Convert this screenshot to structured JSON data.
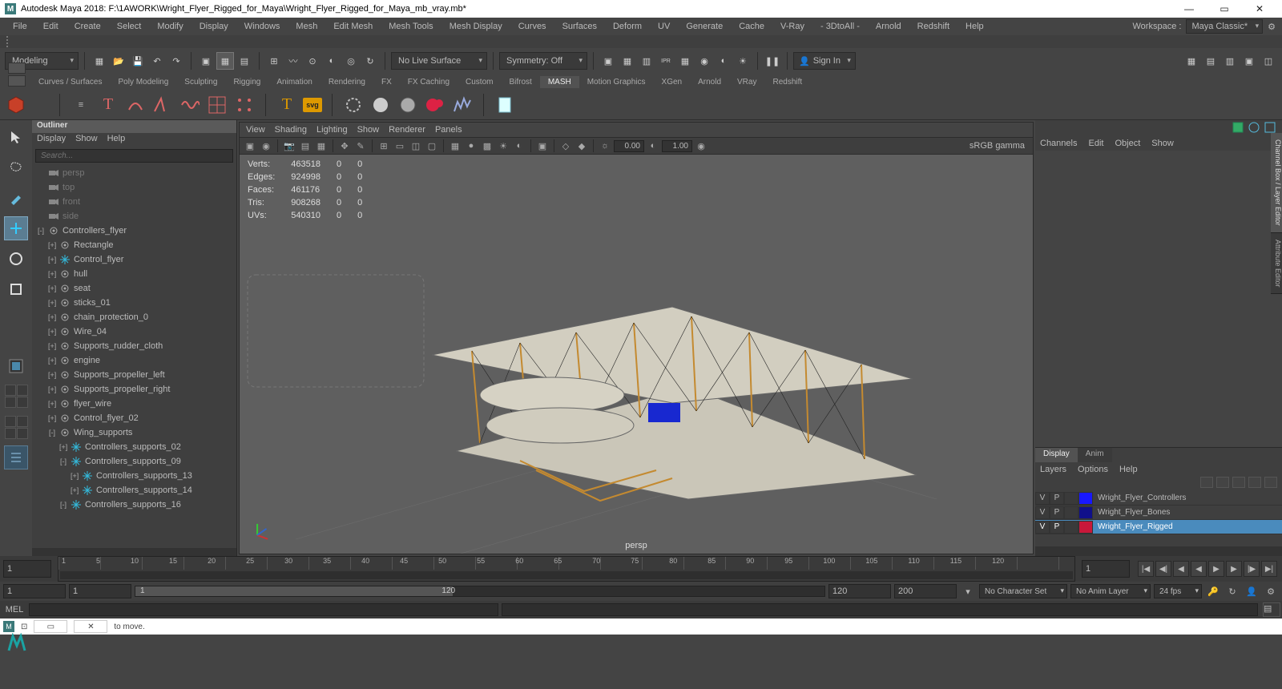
{
  "window": {
    "title": "Autodesk Maya 2018: F:\\1AWORK\\Wright_Flyer_Rigged_for_Maya\\Wright_Flyer_Rigged_for_Maya_mb_vray.mb*"
  },
  "menubar": {
    "items": [
      "File",
      "Edit",
      "Create",
      "Select",
      "Modify",
      "Display",
      "Windows",
      "Mesh",
      "Edit Mesh",
      "Mesh Tools",
      "Mesh Display",
      "Curves",
      "Surfaces",
      "Deform",
      "UV",
      "Generate",
      "Cache",
      "V-Ray",
      "- 3DtoAll -",
      "Arnold",
      "Redshift",
      "Help"
    ],
    "workspace_label": "Workspace :",
    "workspace_value": "Maya Classic*"
  },
  "statusline": {
    "mode": "Modeling",
    "live_surface": "No Live Surface",
    "symmetry": "Symmetry: Off",
    "signin": "Sign In"
  },
  "shelf_tabs": [
    "Curves / Surfaces",
    "Poly Modeling",
    "Sculpting",
    "Rigging",
    "Animation",
    "Rendering",
    "FX",
    "FX Caching",
    "Custom",
    "Bifrost",
    "MASH",
    "Motion Graphics",
    "XGen",
    "Arnold",
    "VRay",
    "Redshift"
  ],
  "shelf_active": "MASH",
  "outliner": {
    "title": "Outliner",
    "menu": [
      "Display",
      "Show",
      "Help"
    ],
    "search_placeholder": "Search...",
    "items": [
      {
        "indent": 0,
        "icon": "cam",
        "label": "persp",
        "dim": true
      },
      {
        "indent": 0,
        "icon": "cam",
        "label": "top",
        "dim": true
      },
      {
        "indent": 0,
        "icon": "cam",
        "label": "front",
        "dim": true
      },
      {
        "indent": 0,
        "icon": "cam",
        "label": "side",
        "dim": true
      },
      {
        "indent": 0,
        "icon": "grp",
        "label": "Controllers_flyer",
        "expand": "-"
      },
      {
        "indent": 1,
        "icon": "grp",
        "label": "Rectangle",
        "expand": "+"
      },
      {
        "indent": 1,
        "icon": "ctl",
        "label": "Control_flyer",
        "expand": "+"
      },
      {
        "indent": 1,
        "icon": "grp",
        "label": "hull",
        "expand": "+"
      },
      {
        "indent": 1,
        "icon": "grp",
        "label": "seat",
        "expand": "+"
      },
      {
        "indent": 1,
        "icon": "grp",
        "label": "sticks_01",
        "expand": "+"
      },
      {
        "indent": 1,
        "icon": "grp",
        "label": "chain_protection_0",
        "expand": "+"
      },
      {
        "indent": 1,
        "icon": "grp",
        "label": "Wire_04",
        "expand": "+"
      },
      {
        "indent": 1,
        "icon": "grp",
        "label": "Supports_rudder_cloth",
        "expand": "+"
      },
      {
        "indent": 1,
        "icon": "grp",
        "label": "engine",
        "expand": "+"
      },
      {
        "indent": 1,
        "icon": "grp",
        "label": "Supports_propeller_left",
        "expand": "+"
      },
      {
        "indent": 1,
        "icon": "grp",
        "label": "Supports_propeller_right",
        "expand": "+"
      },
      {
        "indent": 1,
        "icon": "grp",
        "label": "flyer_wire",
        "expand": "+"
      },
      {
        "indent": 1,
        "icon": "grp",
        "label": "Control_flyer_02",
        "expand": "+"
      },
      {
        "indent": 1,
        "icon": "grp",
        "label": "Wing_supports",
        "expand": "-"
      },
      {
        "indent": 2,
        "icon": "ctl",
        "label": "Controllers_supports_02",
        "expand": "+"
      },
      {
        "indent": 2,
        "icon": "ctl",
        "label": "Controllers_supports_09",
        "expand": "-"
      },
      {
        "indent": 3,
        "icon": "ctl",
        "label": "Controllers_supports_13",
        "expand": "+"
      },
      {
        "indent": 3,
        "icon": "ctl",
        "label": "Controllers_supports_14",
        "expand": "+"
      },
      {
        "indent": 2,
        "icon": "ctl",
        "label": "Controllers_supports_16",
        "expand": "-"
      }
    ]
  },
  "viewport": {
    "menu": [
      "View",
      "Shading",
      "Lighting",
      "Show",
      "Renderer",
      "Panels"
    ],
    "num1": "0.00",
    "num2": "1.00",
    "gamma": "sRGB gamma",
    "camera": "persp",
    "hud": {
      "rows": [
        {
          "k": "Verts:",
          "a": "463518",
          "b": "0",
          "c": "0"
        },
        {
          "k": "Edges:",
          "a": "924998",
          "b": "0",
          "c": "0"
        },
        {
          "k": "Faces:",
          "a": "461176",
          "b": "0",
          "c": "0"
        },
        {
          "k": "Tris:",
          "a": "908268",
          "b": "0",
          "c": "0"
        },
        {
          "k": "UVs:",
          "a": "540310",
          "b": "0",
          "c": "0"
        }
      ]
    }
  },
  "channelbox": {
    "menu": [
      "Channels",
      "Edit",
      "Object",
      "Show"
    ]
  },
  "layers": {
    "tabs": [
      "Display",
      "Anim"
    ],
    "active_tab": "Display",
    "menu": [
      "Layers",
      "Options",
      "Help"
    ],
    "rows": [
      {
        "v": "V",
        "p": "P",
        "swatch": "#1818ff",
        "name": "Wright_Flyer_Controllers",
        "sel": false
      },
      {
        "v": "V",
        "p": "P",
        "swatch": "#10108a",
        "name": "Wright_Flyer_Bones",
        "sel": false
      },
      {
        "v": "V",
        "p": "P",
        "swatch": "#c8183a",
        "name": "Wright_Flyer_Rigged",
        "sel": true
      }
    ]
  },
  "timeline": {
    "current": "1",
    "end": "1",
    "ticks": [
      "1",
      "5",
      "10",
      "15",
      "20",
      "25",
      "30",
      "35",
      "40",
      "45",
      "50",
      "55",
      "60",
      "65",
      "70",
      "75",
      "80",
      "85",
      "90",
      "95",
      "100",
      "105",
      "110",
      "115",
      "120"
    ]
  },
  "range": {
    "start": "1",
    "anim_start": "1",
    "slider_start": "1",
    "slider_end": "120",
    "anim_end": "120",
    "end": "200",
    "charset": "No Character Set",
    "animlayer": "No Anim Layer",
    "fps": "24 fps"
  },
  "cmd": {
    "lang": "MEL"
  },
  "help": " to move."
}
